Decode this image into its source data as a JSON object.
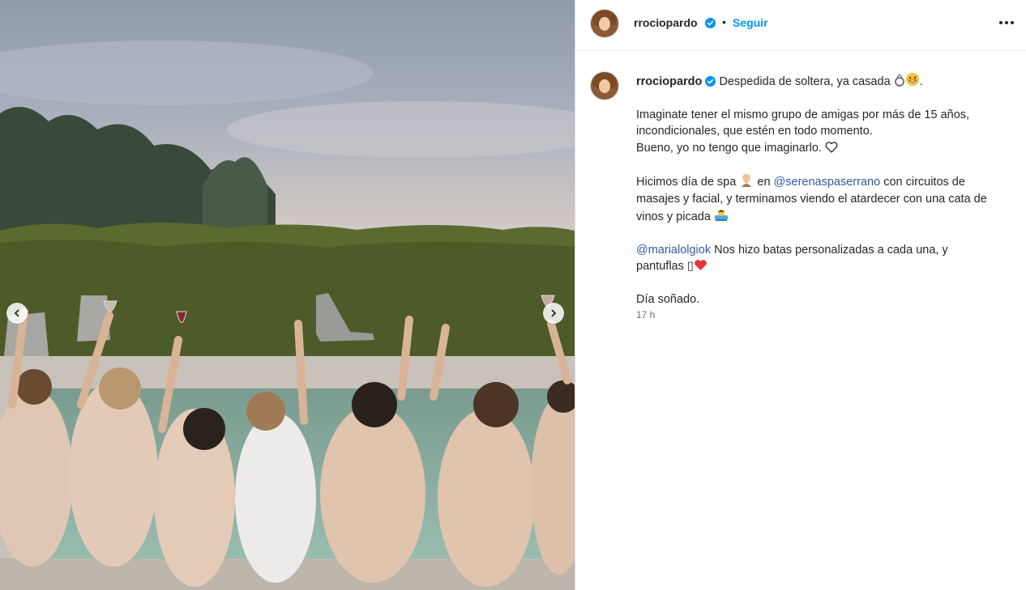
{
  "post": {
    "author": "rrociopardo",
    "follow_label": "Seguir",
    "separator": "•",
    "caption": {
      "line1": "Despedida de soltera, ya casada",
      "line1_end": ".",
      "p2_line1": "Imaginate tener el mismo grupo de amigas por más de 15 años,",
      "p2_line2": "incondicionales, que estén en todo momento.",
      "p2_line3": "Bueno, yo no tengo que imaginarlo.",
      "p3_start": "Hicimos día de spa",
      "p3_en": "en",
      "p3_mention": "@serenaspaserrano",
      "p3_rest1": "con circuitos de",
      "p3_line2": "masajes y facial, y terminamos viendo el atardecer con una cata de",
      "p3_line3": "vinos y picada",
      "p4_mention": "@marialolgiok",
      "p4_rest": "Nos hizo batas personalizadas a cada una, y",
      "p4_line2": "pantuflas",
      "p4_box": "▯",
      "p5": "Día soñado."
    },
    "timestamp": "17 h"
  },
  "icons": [
    "verified-badge-icon",
    "more-options-icon",
    "ring-icon",
    "grin-sweat-icon",
    "heart-outline-icon",
    "spa-person-icon",
    "person-bathing-icon",
    "red-heart-icon",
    "chevron-left-icon",
    "chevron-right-icon"
  ],
  "colors": {
    "follow": "#0095f6",
    "mention": "#385898",
    "verified": "#0095f6",
    "muted": "#737373"
  }
}
